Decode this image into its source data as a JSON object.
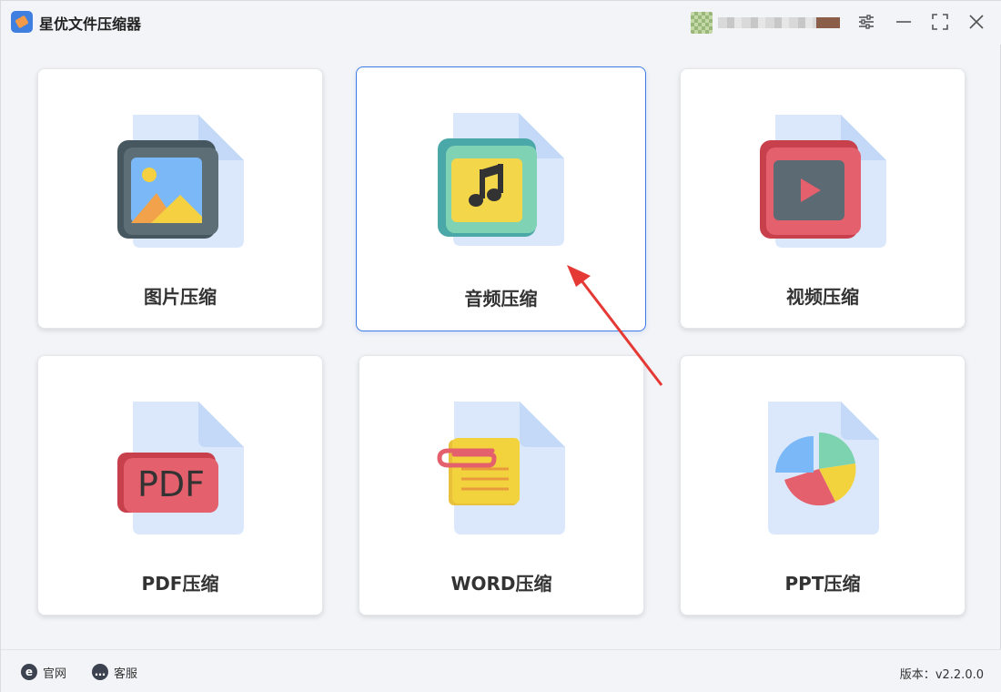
{
  "app": {
    "title": "星优文件压缩器"
  },
  "cards": [
    {
      "label": "图片压缩"
    },
    {
      "label": "音频压缩"
    },
    {
      "label": "视频压缩"
    },
    {
      "label": "PDF压缩"
    },
    {
      "label": "WORD压缩"
    },
    {
      "label": "PPT压缩"
    }
  ],
  "pdf_icon_text": "PDF",
  "footer": {
    "site_label": "官网",
    "service_label": "客服",
    "version_label": "版本：",
    "version_value": "v2.2.0.0"
  },
  "colors": {
    "accent": "#3c7ae6",
    "arrow": "#e53935"
  },
  "icons": [
    "app-logo-icon",
    "settings-icon",
    "minimize-icon",
    "maximize-icon",
    "close-icon",
    "image-file-icon",
    "audio-file-icon",
    "video-file-icon",
    "pdf-file-icon",
    "word-file-icon",
    "ppt-file-icon",
    "browser-icon",
    "chat-icon"
  ]
}
